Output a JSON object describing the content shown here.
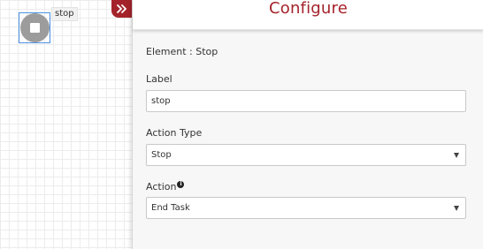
{
  "canvas": {
    "node_label": "stop"
  },
  "panel": {
    "title": "Configure",
    "element_line": "Element : Stop",
    "label_field": {
      "label": "Label",
      "value": "stop"
    },
    "action_type_field": {
      "label": "Action Type",
      "selected": "Stop"
    },
    "action_field": {
      "label": "Action",
      "selected": "End Task"
    }
  },
  "icons": {
    "collapse": "double-chevron-right-icon",
    "info": "info-icon",
    "caret": "chevron-down-icon",
    "stop_node": "stop-icon"
  },
  "colors": {
    "accent": "#a4232b",
    "node_gray": "#9c9c9c",
    "selection_blue": "#4a90e2"
  }
}
